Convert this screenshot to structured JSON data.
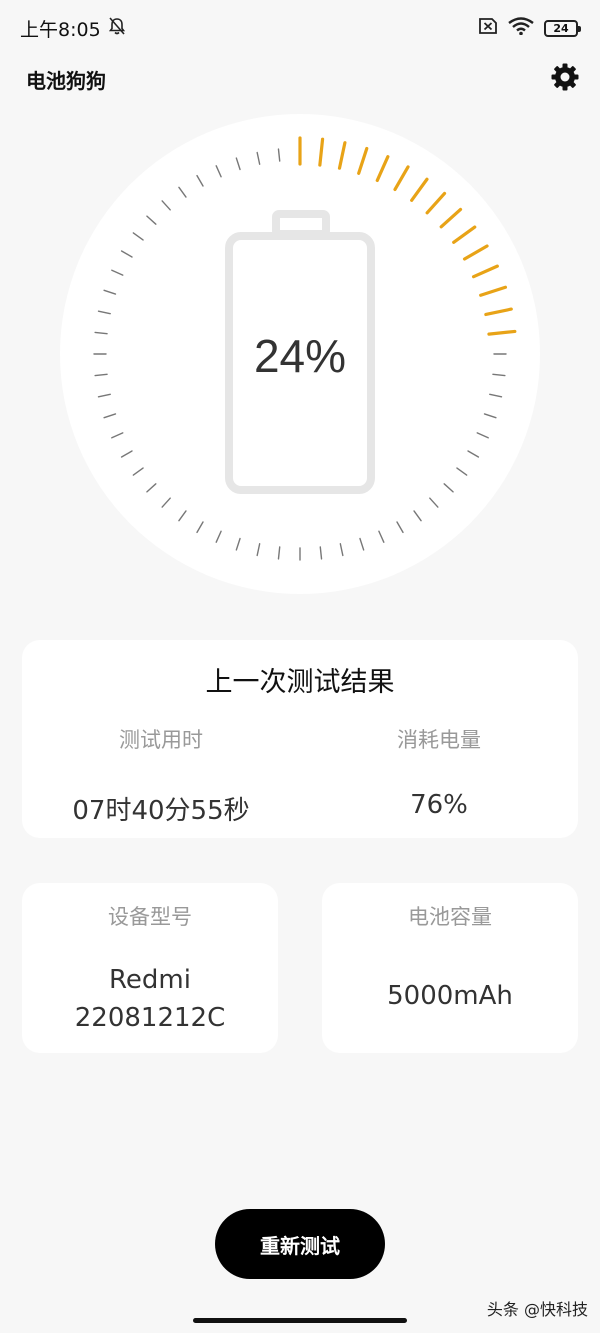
{
  "status_bar": {
    "time": "上午8:05",
    "battery_level": "24",
    "icons": [
      "mute-bell-icon",
      "sim-off-icon",
      "wifi-icon",
      "battery-icon"
    ]
  },
  "app": {
    "title": "电池狗狗",
    "settings_icon": "gear-icon"
  },
  "gauge": {
    "percent_label": "24%",
    "level_fraction": 0.24,
    "accent_color": "#e8a317",
    "tick_color": "#777777"
  },
  "last_test": {
    "title": "上一次测试结果",
    "duration_label": "测试用时",
    "duration_value": "07时40分55秒",
    "consumed_label": "消耗电量",
    "consumed_value": "76%"
  },
  "device": {
    "label": "设备型号",
    "value_line1": "Redmi",
    "value_line2": "22081212C"
  },
  "capacity": {
    "label": "电池容量",
    "value": "5000mAh"
  },
  "actions": {
    "retest_label": "重新测试"
  },
  "watermark": "头条 @快科技"
}
